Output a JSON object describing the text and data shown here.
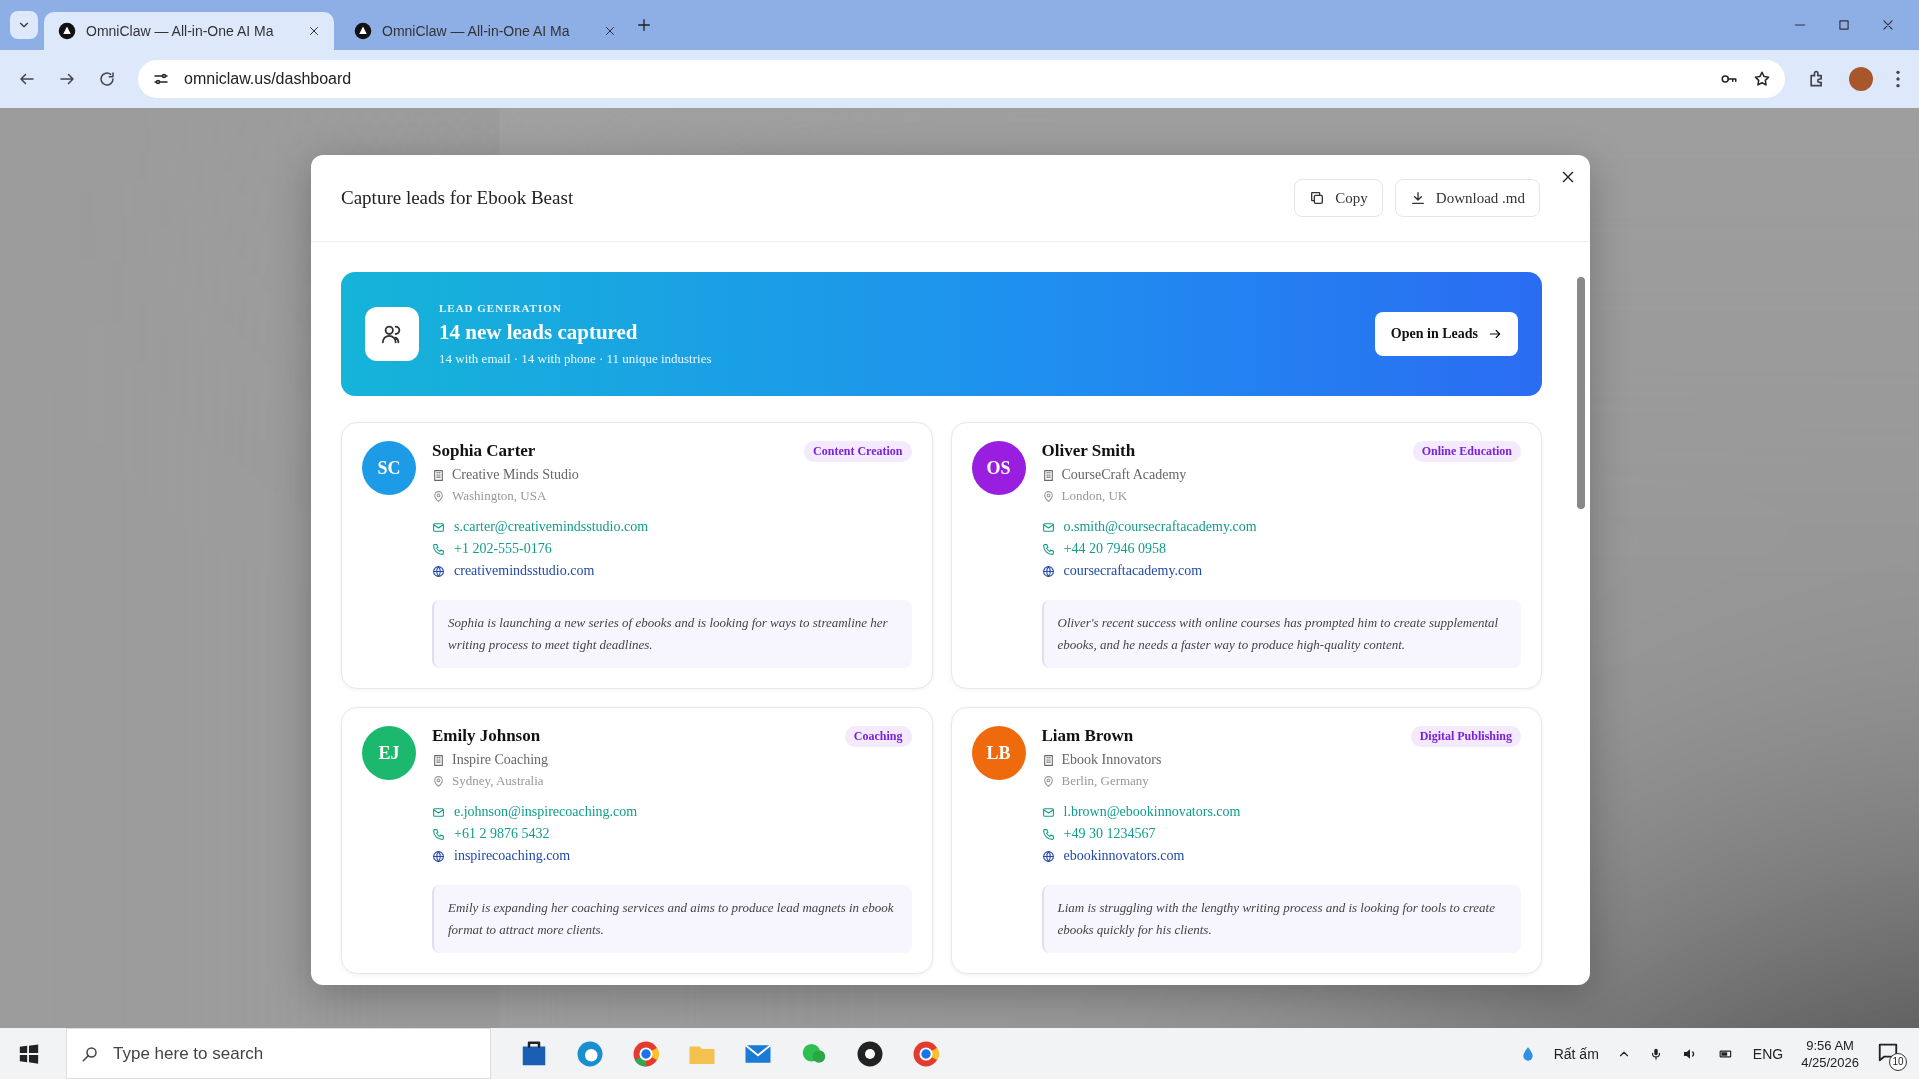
{
  "browser": {
    "tabs": [
      {
        "title": "OmniClaw — All-in-One AI Ma",
        "selected": true
      },
      {
        "title": "OmniClaw — All-in-One AI Ma",
        "selected": false
      }
    ],
    "url": "omniclaw.us/dashboard"
  },
  "modal": {
    "title": "Capture leads for Ebook Beast",
    "buttons": [
      "Copy",
      "Download .md"
    ],
    "banner": {
      "eyebrow": "LEAD GENERATION",
      "headline": "14 new leads captured",
      "stats": "14 with email · 14 with phone · 11 unique industries",
      "button": "Open in Leads"
    },
    "leads": [
      {
        "initials": "SC",
        "color": "#1d9be6",
        "name": "Sophia Carter",
        "tag": "Content Creation",
        "company": "Creative Minds Studio",
        "location": "Washington, USA",
        "email": "s.carter@creativemindsstudio.com",
        "phone": "+1 202-555-0176",
        "website": "creativemindsstudio.com",
        "note": "Sophia is launching a new series of ebooks and is looking for ways to streamline her writing process to meet tight deadlines."
      },
      {
        "initials": "OS",
        "color": "#9a1ee0",
        "name": "Oliver Smith",
        "tag": "Online Education",
        "company": "CourseCraft Academy",
        "location": "London, UK",
        "email": "o.smith@coursecraftacademy.com",
        "phone": "+44 20 7946 0958",
        "website": "coursecraftacademy.com",
        "note": "Oliver's recent success with online courses has prompted him to create supplemental ebooks, and he needs a faster way to produce high-quality content."
      },
      {
        "initials": "EJ",
        "color": "#1cb86e",
        "name": "Emily Johnson",
        "tag": "Coaching",
        "company": "Inspire Coaching",
        "location": "Sydney, Australia",
        "email": "e.johnson@inspirecoaching.com",
        "phone": "+61 2 9876 5432",
        "website": "inspirecoaching.com",
        "note": "Emily is expanding her coaching services and aims to produce lead magnets in ebook format to attract more clients."
      },
      {
        "initials": "LB",
        "color": "#ee6a0c",
        "name": "Liam Brown",
        "tag": "Digital Publishing",
        "company": "Ebook Innovators",
        "location": "Berlin, Germany",
        "email": "l.brown@ebookinnovators.com",
        "phone": "+49 30 1234567",
        "website": "ebookinnovators.com",
        "note": "Liam is struggling with the lengthy writing process and is looking for tools to create ebooks quickly for his clients."
      }
    ]
  },
  "taskbar": {
    "search_placeholder": "Type here to search",
    "weather": "Rất ấm",
    "language": "ENG",
    "time": "9:56 AM",
    "date": "4/25/2026",
    "notifications": "10"
  }
}
